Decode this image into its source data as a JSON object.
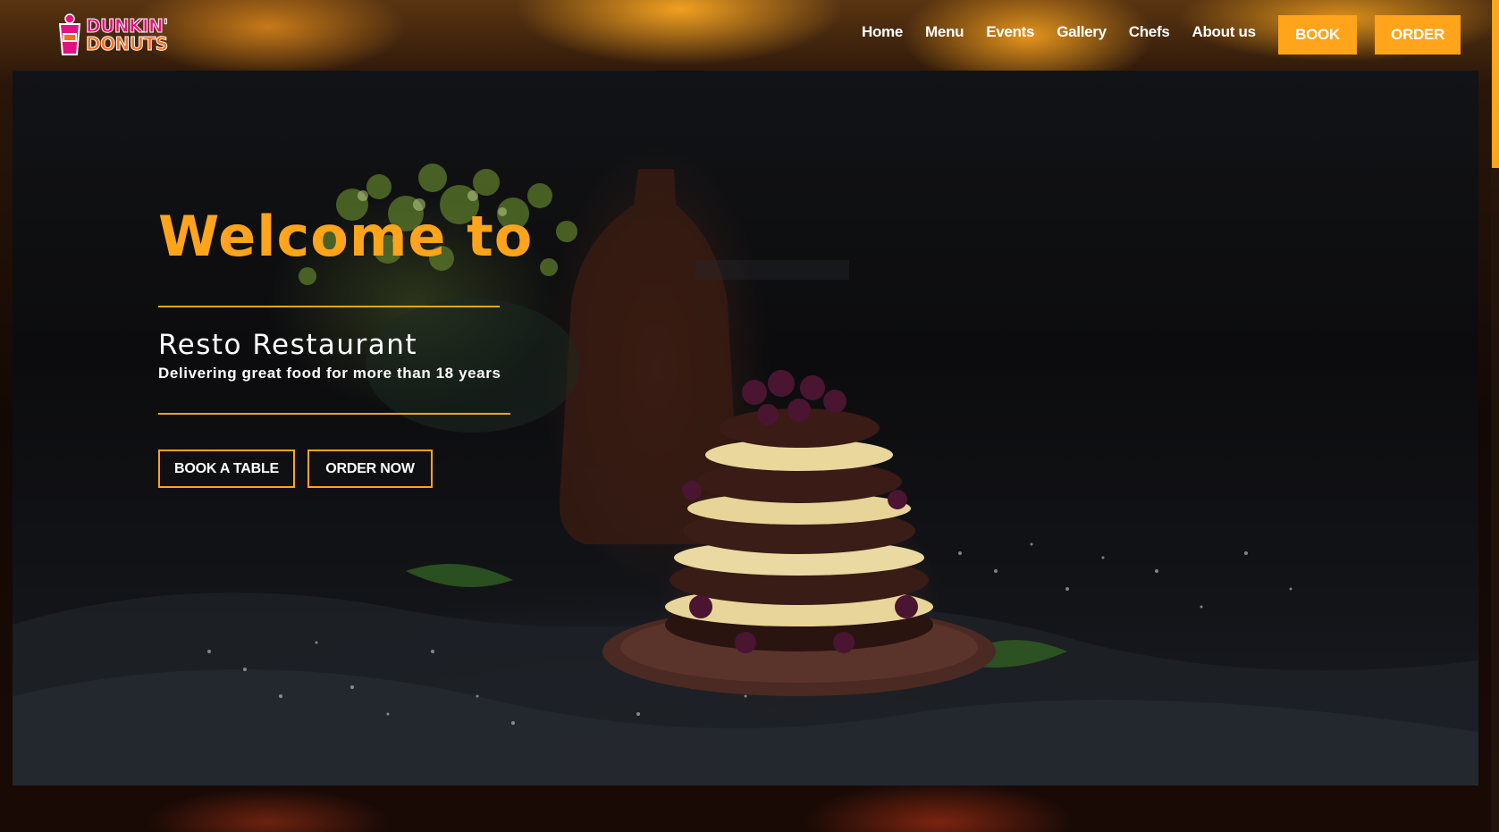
{
  "brand": {
    "logo_line1": "DUNKIN'",
    "logo_line2": "DONUTS",
    "colors": {
      "pink": "#e11383",
      "orange": "#ff6e1b"
    }
  },
  "nav": {
    "links": [
      "Home",
      "Menu",
      "Events",
      "Gallery",
      "Chefs",
      "About us"
    ],
    "book_label": "BOOK",
    "order_label": "ORDER"
  },
  "hero": {
    "welcome": "Welcome to",
    "restaurant_name": "Resto Restaurant",
    "tagline": "Delivering great food for more than 18 years",
    "book_table_label": "BOOK A TABLE",
    "order_now_label": "ORDER NOW"
  },
  "theme": {
    "accent": "#ffa41b",
    "text": "#ffffff"
  }
}
